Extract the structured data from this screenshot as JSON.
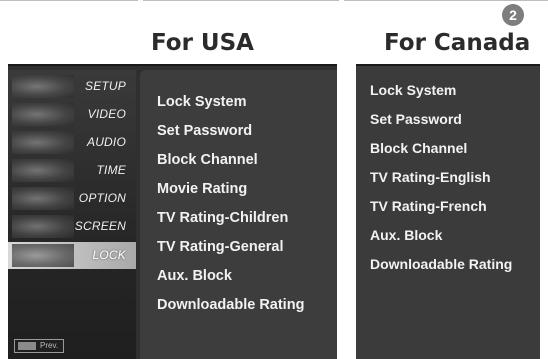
{
  "step_badge": "2",
  "usa": {
    "heading": "For USA",
    "sidebar": {
      "items": [
        {
          "label": "SETUP",
          "icon": "setup-thumbnail-icon"
        },
        {
          "label": "VIDEO",
          "icon": "video-thumbnail-icon"
        },
        {
          "label": "AUDIO",
          "icon": "audio-thumbnail-icon"
        },
        {
          "label": "TIME",
          "icon": "time-thumbnail-icon"
        },
        {
          "label": "OPTION",
          "icon": "option-thumbnail-icon"
        },
        {
          "label": "SCREEN",
          "icon": "screen-thumbnail-icon"
        },
        {
          "label": "LOCK",
          "icon": "lock-thumbnail-icon",
          "selected": true
        }
      ],
      "footer_label": "Prev."
    },
    "menu_items": [
      "Lock System",
      "Set Password",
      "Block Channel",
      "Movie Rating",
      "TV Rating-Children",
      "TV Rating-General",
      "Aux. Block",
      "Downloadable Rating"
    ]
  },
  "canada": {
    "heading": "For Canada",
    "menu_items": [
      "Lock System",
      "Set Password",
      "Block Channel",
      "TV Rating-English",
      "TV Rating-French",
      "Aux. Block",
      "Downloadable Rating"
    ]
  },
  "colors": {
    "panel_dark": "#2f2f2f",
    "menu_bg": "#3d3d3d",
    "menu_text": "#f2f2f2",
    "selected_item": "#c8c8c8",
    "badge": "#7e7e7e"
  }
}
